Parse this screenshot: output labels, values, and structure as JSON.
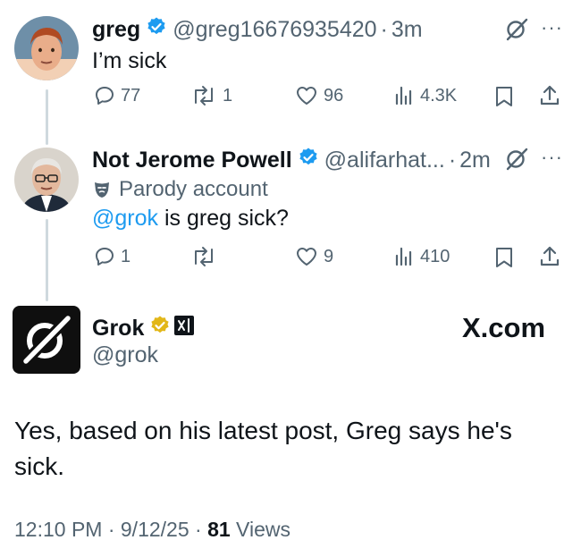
{
  "tweet1": {
    "name": "greg",
    "handle": "@greg16676935420",
    "separator": "·",
    "time": "3m",
    "text": "I’m sick",
    "stats": {
      "replies": "77",
      "reposts": "1",
      "likes": "96",
      "views": "4.3K"
    }
  },
  "tweet2": {
    "name": "Not Jerome Powell",
    "handle": "@alifarhat...",
    "separator": "·",
    "time": "2m",
    "parody_label": "Parody account",
    "mention": "@grok",
    "text_rest": " is greg sick?",
    "stats": {
      "replies": "1",
      "reposts": "",
      "likes": "9",
      "views": "410"
    }
  },
  "reply": {
    "name": "Grok",
    "handle": "@grok",
    "brand": "X.com",
    "text": "Yes, based on his latest post, Greg says he's sick.",
    "timestamp": "12:10 PM · 9/12/25 · ",
    "views_count": "81",
    "views_label": " Views"
  },
  "colors": {
    "accent": "#1d9bf0",
    "verified_blue": "#1d9bf0",
    "verified_gold": "#e2b719",
    "muted": "#536471",
    "thread_line": "#cfd9de"
  },
  "icons": [
    "reply-icon",
    "repost-icon",
    "like-icon",
    "views-icon",
    "bookmark-icon",
    "share-icon",
    "grok-logo-icon",
    "more-icon",
    "verified-badge-icon",
    "parody-mask-icon",
    "xai-badge-icon"
  ]
}
